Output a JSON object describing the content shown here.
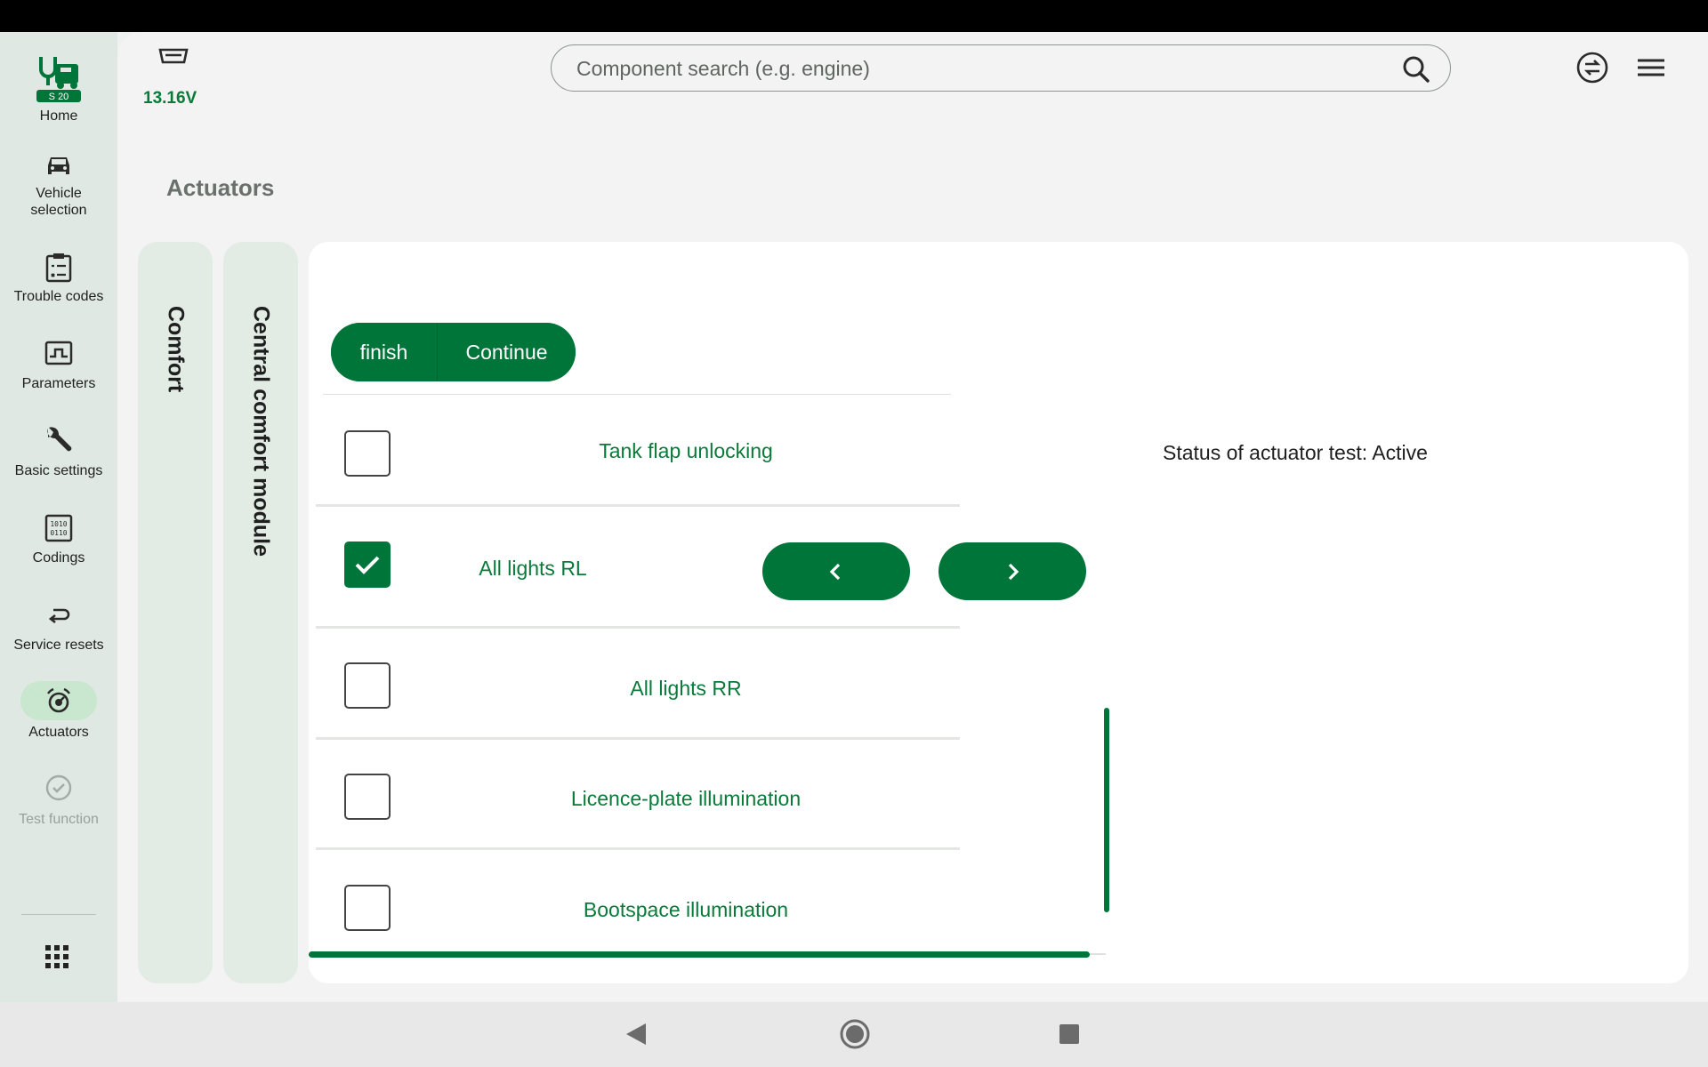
{
  "sidebar": {
    "items": [
      {
        "label": "Home",
        "badge": "S 20",
        "icon": "stethoscope-truck-logo-icon"
      },
      {
        "label": "Vehicle selection",
        "icon": "car-icon"
      },
      {
        "label": "Trouble codes",
        "icon": "clipboard-list-icon"
      },
      {
        "label": "Parameters",
        "icon": "signal-graph-icon"
      },
      {
        "label": "Basic settings",
        "icon": "wrench-icon"
      },
      {
        "label": "Codings",
        "icon": "binary-chip-icon"
      },
      {
        "label": "Service resets",
        "icon": "return-arrow-icon"
      },
      {
        "label": "Actuators",
        "icon": "actuator-dial-icon",
        "active": true
      },
      {
        "label": "Test function",
        "icon": "check-circle-icon",
        "disabled": true
      }
    ],
    "apps_icon": "grid-apps-icon"
  },
  "header": {
    "voltage": "13.16V",
    "search_placeholder": "Component search (e.g. engine)",
    "icons": [
      "obd-connector-icon",
      "search-icon",
      "swap-circle-icon",
      "menu-icon"
    ]
  },
  "page_title": "Actuators",
  "tabs": [
    "Comfort",
    "Central comfort module"
  ],
  "actions": {
    "finish": "finish",
    "continue": "Continue"
  },
  "actuators": [
    {
      "label": "Tank flap unlocking",
      "checked": false
    },
    {
      "label": "All lights RL",
      "checked": true
    },
    {
      "label": "All lights RR",
      "checked": false
    },
    {
      "label": "Licence-plate illumination",
      "checked": false
    },
    {
      "label": "Bootspace illumination",
      "checked": false
    }
  ],
  "status": "Status of actuator test: Active",
  "colors": {
    "accent": "#00753a",
    "text_green": "#0a7a3a",
    "sidebar_bg": "#dfe8e2",
    "active_pill": "#c9e7cf"
  }
}
